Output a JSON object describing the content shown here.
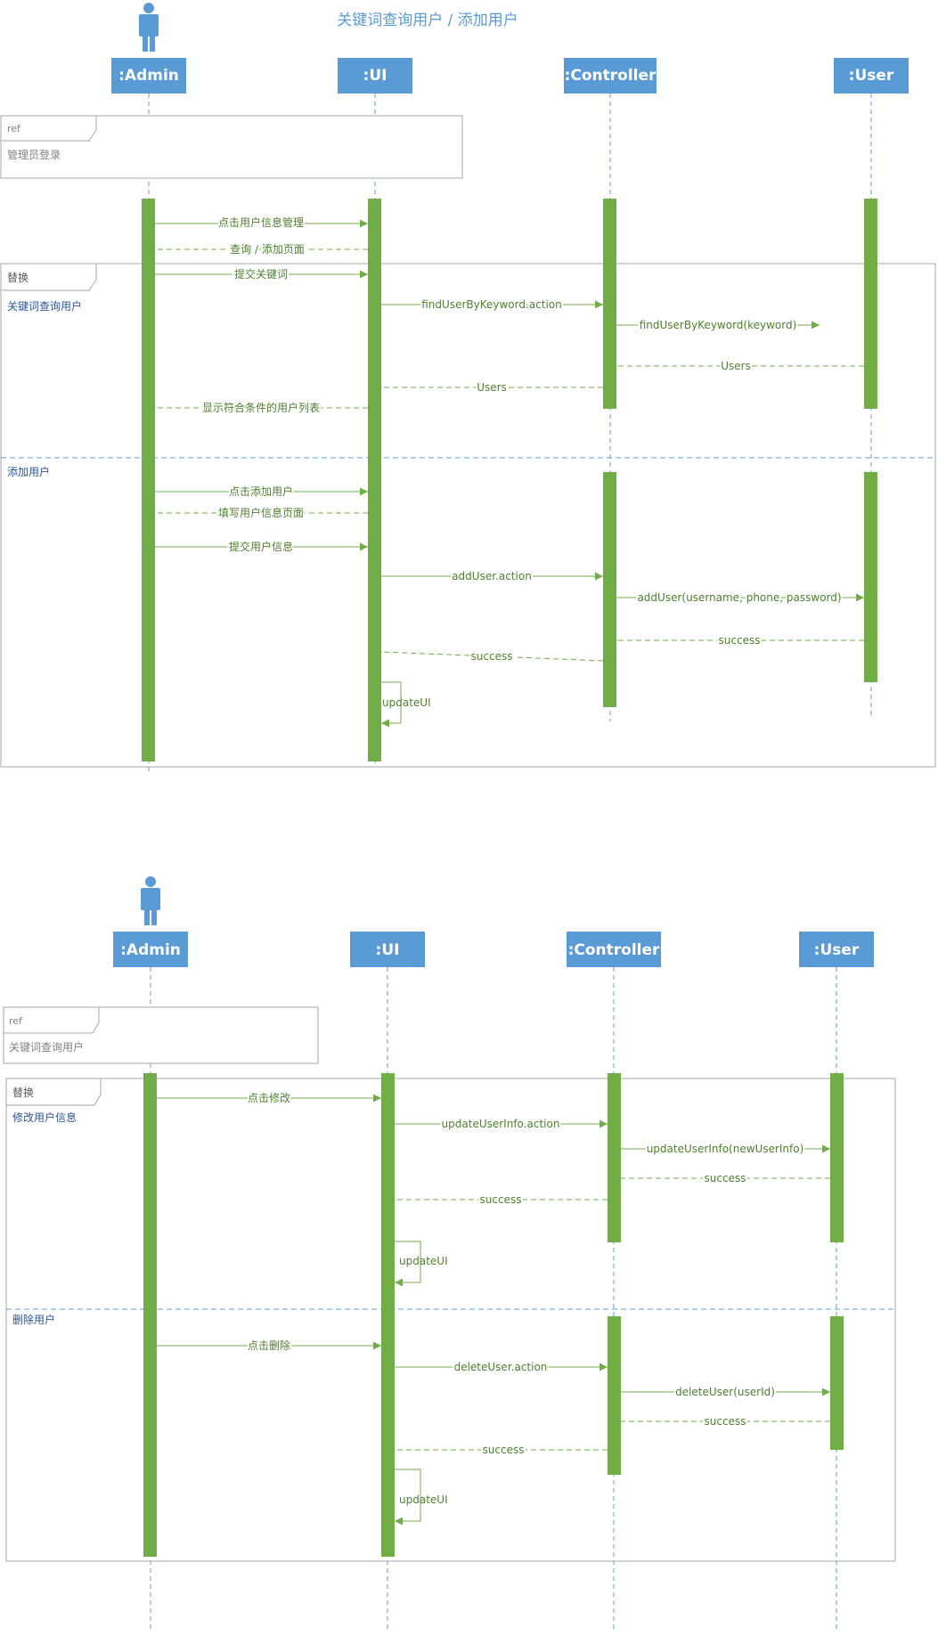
{
  "diagram1": {
    "title": "关键词查询用户 / 添加用户",
    "lifelines": {
      "admin": ":Admin",
      "ui": ":UI",
      "controller": ":Controller",
      "user": ":User"
    },
    "ref": {
      "tag": "ref",
      "text": "管理员登录"
    },
    "alt": {
      "tag": "替换",
      "op1_label": "关键词查询用户",
      "op2_label": "添加用户"
    },
    "messages": {
      "m1": "点击用户信息管理",
      "m2": "查询 / 添加页面",
      "m3": "提交关键词",
      "m4": "findUserByKeyword.action",
      "m5": "findUserByKeyword(keyword)",
      "m6": "Users",
      "m7": "Users",
      "m8": "显示符合条件的用户列表",
      "m9": "点击添加用户",
      "m10": "填写用户信息页面",
      "m11": "提交用户信息",
      "m12": "addUser.action",
      "m13": "addUser(username, phone, password)",
      "m14": "success",
      "m15": "success",
      "m16": "updateUI"
    }
  },
  "diagram2": {
    "lifelines": {
      "admin": ":Admin",
      "ui": ":UI",
      "controller": ":Controller",
      "user": ":User"
    },
    "ref": {
      "tag": "ref",
      "text": "关键词查询用户"
    },
    "alt": {
      "tag": "替换",
      "op1_label": "修改用户信息",
      "op2_label": "删除用户"
    },
    "messages": {
      "m1": "点击修改",
      "m2": "updateUserInfo.action",
      "m3": "updateUserInfo(newUserInfo)",
      "m4": "success",
      "m5": "success",
      "m6": "updateUI",
      "m7": "点击删除",
      "m8": "deleteUser.action",
      "m9": "deleteUser(userId)",
      "m10": "success",
      "m11": "success",
      "m12": "updateUI"
    }
  },
  "colors": {
    "lifeline_box": "#5b9bd5",
    "lifeline_text": "#ffffff",
    "activation": "#70ad47",
    "message": "#70ad47",
    "message_text": "#4e7f2e",
    "fragment_border": "#a6a6a6",
    "operand_label": "#2f5597",
    "title": "#5b9bd5"
  }
}
